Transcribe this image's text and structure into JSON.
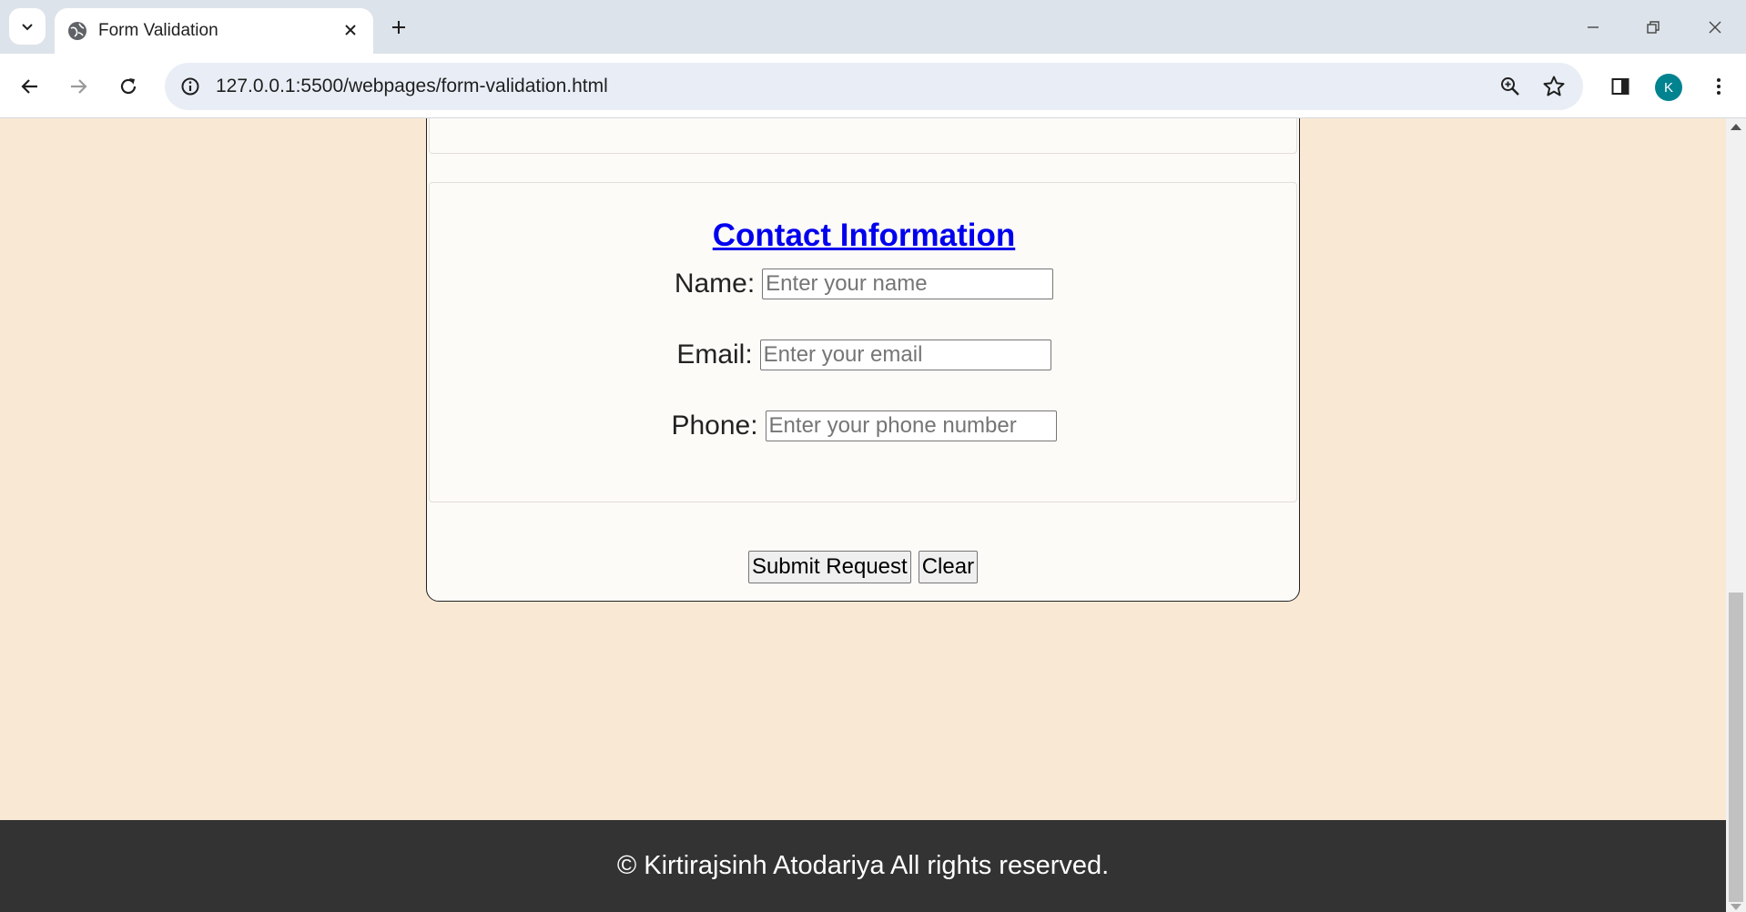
{
  "browser": {
    "tab_title": "Form Validation",
    "url": "127.0.0.1:5500/webpages/form-validation.html",
    "profile_initial": "K",
    "accent_color": "#00838f"
  },
  "form": {
    "legend": "Contact Information",
    "fields": [
      {
        "label": "Name:",
        "placeholder": "Enter your name"
      },
      {
        "label": "Email:",
        "placeholder": "Enter your email"
      },
      {
        "label": "Phone:",
        "placeholder": "Enter your phone number"
      }
    ],
    "submit_label": "Submit Request",
    "clear_label": "Clear"
  },
  "footer": {
    "text": "© Kirtirajsinh Atodariya All rights reserved."
  },
  "colors": {
    "page_background": "#f9e9d4",
    "legend_link": "#0000ee",
    "footer_background": "#333333"
  }
}
